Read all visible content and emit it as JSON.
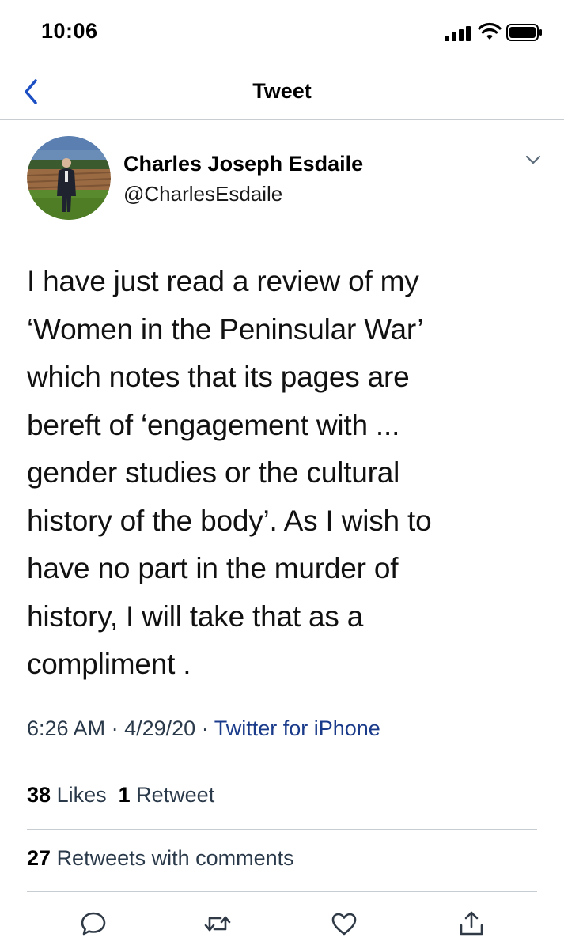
{
  "status_bar": {
    "time": "10:06",
    "icons": [
      "signal-icon",
      "wifi-icon",
      "battery-icon"
    ]
  },
  "nav": {
    "title": "Tweet",
    "back_icon": "back-chevron-icon"
  },
  "author": {
    "name": "Charles Joseph Esdaile",
    "handle": "@CharlesEsdaile",
    "menu_icon": "chevron-down-icon"
  },
  "tweet": {
    "text": "I have just read a review of my\n‘Women in the Peninsular War’\nwhich notes that its pages are\nbereft of ‘engagement with ...\ngender studies or the cultural\nhistory of the body’.  As I wish to\nhave no part in the murder of\nhistory, I will take that as a\ncompliment ."
  },
  "meta": {
    "time": "6:26 AM",
    "date": "4/29/20",
    "separator": "·",
    "via": "Twitter for iPhone"
  },
  "stats": {
    "likes_count": "38",
    "likes_label": "Likes",
    "retweets_count": "1",
    "retweets_label": "Retweet"
  },
  "retweets_with_comments": {
    "count": "27",
    "label": "Retweets with comments"
  },
  "actions": [
    "reply-icon",
    "retweet-icon",
    "like-icon",
    "share-icon"
  ],
  "colors": {
    "accent": "#1d4fc4",
    "via_link": "#1a3a8a",
    "divider": "#c8cdd2"
  }
}
